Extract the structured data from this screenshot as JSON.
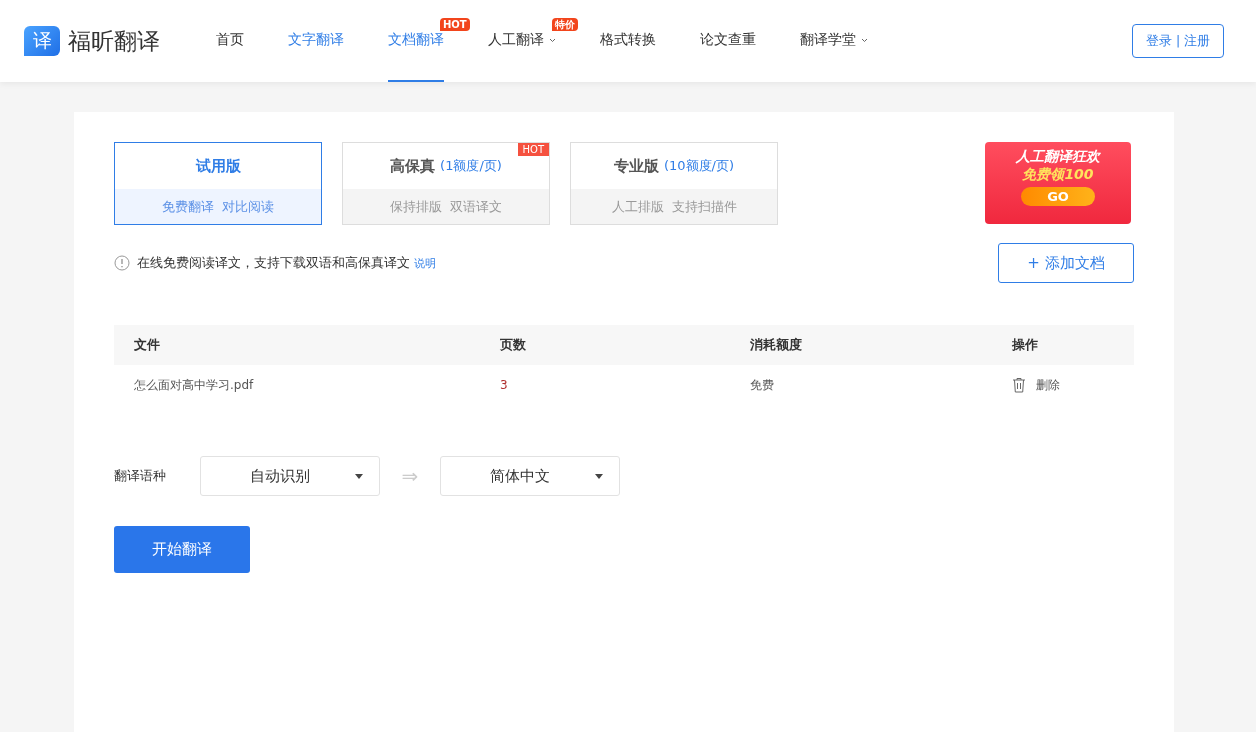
{
  "logo": {
    "glyph": "译",
    "name": "福昕翻译"
  },
  "nav": [
    {
      "label": "首页",
      "selected": false,
      "emphasized": false,
      "has_menu": false
    },
    {
      "label": "文字翻译",
      "selected": false,
      "emphasized": true,
      "has_menu": false
    },
    {
      "label": "文档翻译",
      "selected": true,
      "emphasized": true,
      "has_menu": false,
      "badge": "HOT"
    },
    {
      "label": "人工翻译",
      "selected": false,
      "emphasized": false,
      "has_menu": true,
      "badge": "特价"
    },
    {
      "label": "格式转换",
      "selected": false,
      "emphasized": false,
      "has_menu": false
    },
    {
      "label": "论文查重",
      "selected": false,
      "emphasized": false,
      "has_menu": false
    },
    {
      "label": "翻译学堂",
      "selected": false,
      "emphasized": false,
      "has_menu": true
    }
  ],
  "auth": {
    "login": "登录",
    "separator": "|",
    "register": "注册"
  },
  "plans": [
    {
      "title": "试用版",
      "selected": true,
      "features": [
        "免费翻译",
        "对比阅读"
      ]
    },
    {
      "title": "高保真",
      "price": "(1额度/页)",
      "selected": false,
      "badge": "HOT",
      "features": [
        "保持排版",
        "双语译文"
      ]
    },
    {
      "title": "专业版",
      "price": "(10额度/页)",
      "selected": false,
      "features": [
        "人工排版",
        "支持扫描件"
      ]
    }
  ],
  "promo": {
    "line1": "人工翻译狂欢",
    "line2": "免费领100",
    "button": "GO"
  },
  "notice": {
    "text": "在线免费阅读译文，支持下载双语和高保真译文",
    "link": "说明"
  },
  "add_button": "+ 添加文档",
  "table": {
    "columns": [
      "文件",
      "页数",
      "消耗额度",
      "操作"
    ],
    "rows": [
      {
        "file": "怎么面对高中学习.pdf",
        "pages": "3",
        "cost": "免费",
        "action": "删除"
      }
    ]
  },
  "language": {
    "label": "翻译语种",
    "source": "自动识别",
    "target": "简体中文",
    "arrow": "⇒"
  },
  "start_button": "开始翻译"
}
